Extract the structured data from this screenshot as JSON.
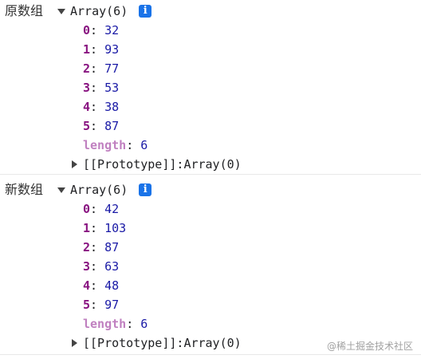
{
  "logs": [
    {
      "label": "原数组",
      "summary": "Array(6)",
      "info_glyph": "i",
      "items": [
        {
          "key": "0",
          "value": "32"
        },
        {
          "key": "1",
          "value": "93"
        },
        {
          "key": "2",
          "value": "77"
        },
        {
          "key": "3",
          "value": "53"
        },
        {
          "key": "4",
          "value": "38"
        },
        {
          "key": "5",
          "value": "87"
        }
      ],
      "length_key": "length",
      "length_value": "6",
      "prototype_key": "[[Prototype]]",
      "prototype_value": "Array(0)"
    },
    {
      "label": "新数组",
      "summary": "Array(6)",
      "info_glyph": "i",
      "items": [
        {
          "key": "0",
          "value": "42"
        },
        {
          "key": "1",
          "value": "103"
        },
        {
          "key": "2",
          "value": "87"
        },
        {
          "key": "3",
          "value": "63"
        },
        {
          "key": "4",
          "value": "48"
        },
        {
          "key": "5",
          "value": "97"
        }
      ],
      "length_key": "length",
      "length_value": "6",
      "prototype_key": "[[Prototype]]",
      "prototype_value": "Array(0)"
    }
  ],
  "separator": ": ",
  "watermark": "@稀土掘金技术社区",
  "colors": {
    "key": "#881280",
    "length_key": "#c080c0",
    "number": "#1a1aa6",
    "info_icon": "#1a73e8"
  },
  "icons": {
    "expand": "triangle-down-icon",
    "collapse": "triangle-right-icon",
    "info": "info-icon"
  }
}
